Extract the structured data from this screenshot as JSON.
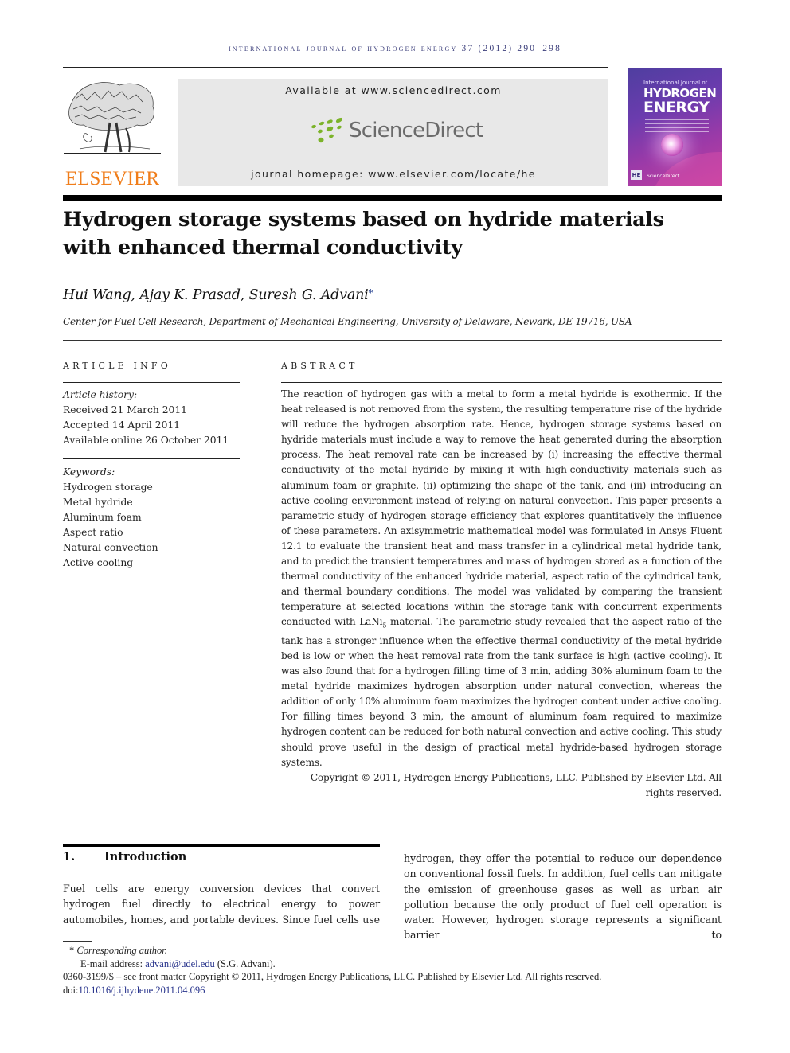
{
  "running_head": "International Journal of Hydrogen Energy 37 (2012) 290–298",
  "header": {
    "publisher_logo_text": "ELSEVIER",
    "available_at": "Available at www.sciencedirect.com",
    "sciencedirect_logo_text": "ScienceDirect",
    "journal_homepage": "journal homepage: www.elsevier.com/locate/he",
    "cover": {
      "line1": "International Journal of",
      "line2": "HYDROGEN",
      "line3": "ENERGY",
      "badge": "HE",
      "footer": "ScienceDirect"
    },
    "colors": {
      "elsevier_orange": "#f07d1a",
      "sciencedirect_green": "#7cb32a",
      "sciencedirect_gray": "#6b6b6b",
      "cover_purple": "#6b3cae",
      "link_blue": "#24308a"
    }
  },
  "article": {
    "title_line1": "Hydrogen storage systems based on hydride materials",
    "title_line2": "with enhanced thermal conductivity",
    "authors": "Hui Wang, Ajay K. Prasad, Suresh G. Advani",
    "author_mark": "*",
    "affiliation": "Center for Fuel Cell Research, Department of Mechanical Engineering, University of Delaware, Newark, DE 19716, USA"
  },
  "article_info": {
    "heading": "ARTICLE INFO",
    "history_label": "Article history:",
    "history": [
      "Received 21 March 2011",
      "Accepted 14 April 2011",
      "Available online 26 October 2011"
    ],
    "keywords_label": "Keywords:",
    "keywords": [
      "Hydrogen storage",
      "Metal hydride",
      "Aluminum foam",
      "Aspect ratio",
      "Natural convection",
      "Active cooling"
    ]
  },
  "abstract": {
    "heading": "ABSTRACT",
    "text_part1": "The reaction of hydrogen gas with a metal to form a metal hydride is exothermic. If the heat released is not removed from the system, the resulting temperature rise of the hydride will reduce the hydrogen absorption rate. Hence, hydrogen storage systems based on hydride materials must include a way to remove the heat generated during the absorption process. The heat removal rate can be increased by (i) increasing the effective thermal conductivity of the metal hydride by mixing it with high-conductivity materials such as aluminum foam or graphite, (ii) optimizing the shape of the tank, and (iii) introducing an active cooling environment instead of relying on natural convection. This paper presents a parametric study of hydrogen storage efficiency that explores quantitatively the influence of these parameters. An axisymmetric mathematical model was formulated in Ansys Fluent 12.1 to evaluate the transient heat and mass transfer in a cylindrical metal hydride tank, and to predict the transient temperatures and mass of hydrogen stored as a function of the thermal conductivity of the enhanced hydride material, aspect ratio of the cylindrical tank, and thermal boundary conditions. The model was validated by comparing the transient temperature at selected locations within the storage tank with concurrent experiments conducted with LaNi",
    "subscript": "5",
    "text_part2": " material. The parametric study revealed that the aspect ratio of the tank has a stronger influence when the effective thermal conductivity of the metal hydride bed is low or when the heat removal rate from the tank surface is high (active cooling). It was also found that for a hydrogen filling time of 3 min, adding 30% aluminum foam to the metal hydride maximizes hydrogen absorption under natural convection, whereas the addition of only 10% aluminum foam maximizes the hydrogen content under active cooling. For filling times beyond 3 min, the amount of aluminum foam required to maximize hydrogen content can be reduced for both natural convection and active cooling. This study should prove useful in the design of practical metal hydride-based hydrogen storage systems.",
    "copyright": "Copyright © 2011, Hydrogen Energy Publications, LLC. Published by Elsevier Ltd. All rights reserved."
  },
  "introduction": {
    "number": "1.",
    "heading": "Introduction",
    "left_column": "Fuel cells are energy conversion devices that convert hydrogen fuel directly to electrical energy to power automobiles, homes, and portable devices. Since fuel cells use",
    "right_column": "hydrogen, they offer the potential to reduce our dependence on conventional fossil fuels. In addition, fuel cells can mitigate the emission of greenhouse gases as well as urban air pollution because the only product of fuel cell operation is water. However, hydrogen storage represents a significant barrier to"
  },
  "footnotes": {
    "corresponding_mark": "*",
    "corresponding_label": "Corresponding author.",
    "email_label": "E-mail address: ",
    "email": "advani@udel.edu",
    "email_owner": " (S.G. Advani).",
    "issn_line": "0360-3199/$ – see front matter Copyright © 2011, Hydrogen Energy Publications, LLC. Published by Elsevier Ltd. All rights reserved.",
    "doi_label": "doi:",
    "doi": "10.1016/j.ijhydene.2011.04.096"
  }
}
